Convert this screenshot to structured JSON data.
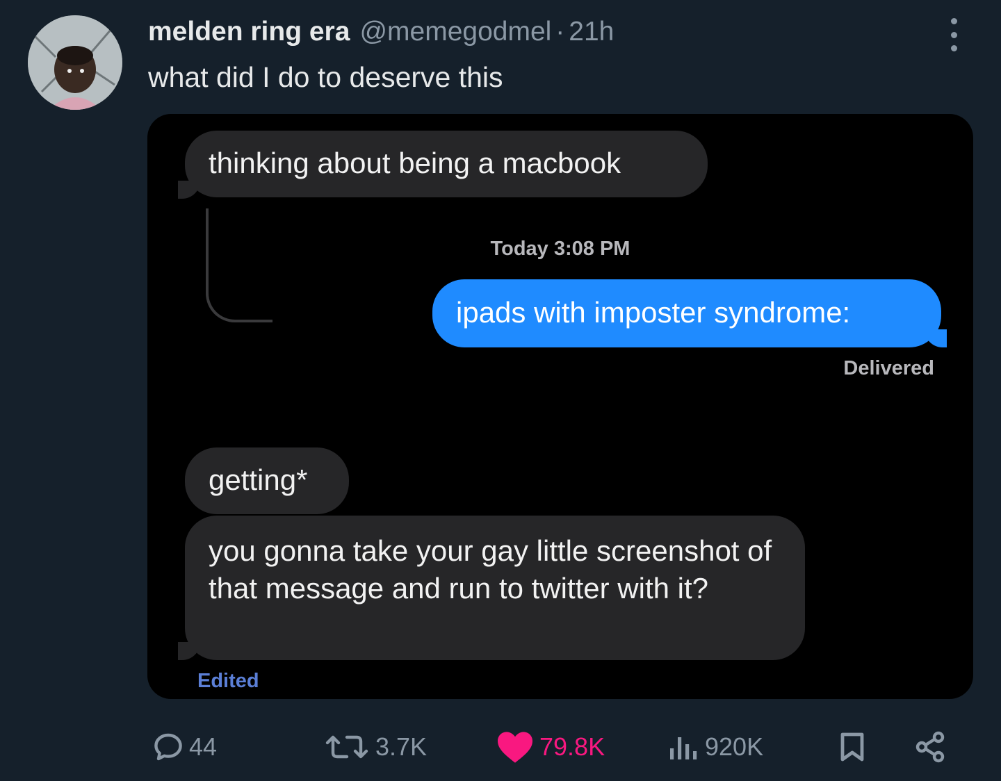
{
  "tweet": {
    "display_name": "melden ring era",
    "handle": "@memegodmel",
    "separator": "·",
    "time": "21h",
    "text": "what did I do to deserve this"
  },
  "screenshot": {
    "messages": [
      {
        "from": "them",
        "text": "thinking about being a macbook"
      },
      {
        "from": "me",
        "text": "ipads with imposter syndrome:"
      },
      {
        "from": "them",
        "text": "getting*"
      },
      {
        "from": "them",
        "text": "you gonna take your gay little screenshot of that message and run to twitter with it?"
      }
    ],
    "timestamp": "Today 3:08 PM",
    "delivered": "Delivered",
    "edited": "Edited"
  },
  "actions": {
    "replies": "44",
    "retweets": "3.7K",
    "likes": "79.8K",
    "views": "920K"
  },
  "icons": {
    "more": "more-vertical-icon",
    "reply": "comment-icon",
    "retweet": "retweet-icon",
    "like": "heart-filled-icon",
    "views": "analytics-icon",
    "bookmark": "bookmark-icon",
    "share": "share-icon"
  },
  "colors": {
    "background": "#15202b",
    "media_background": "#000000",
    "grey_bubble": "#262628",
    "blue_bubble": "#1f8bff",
    "muted_text": "#8b98a5",
    "like_pink": "#f91880",
    "edited_blue": "#5b7fd6"
  }
}
